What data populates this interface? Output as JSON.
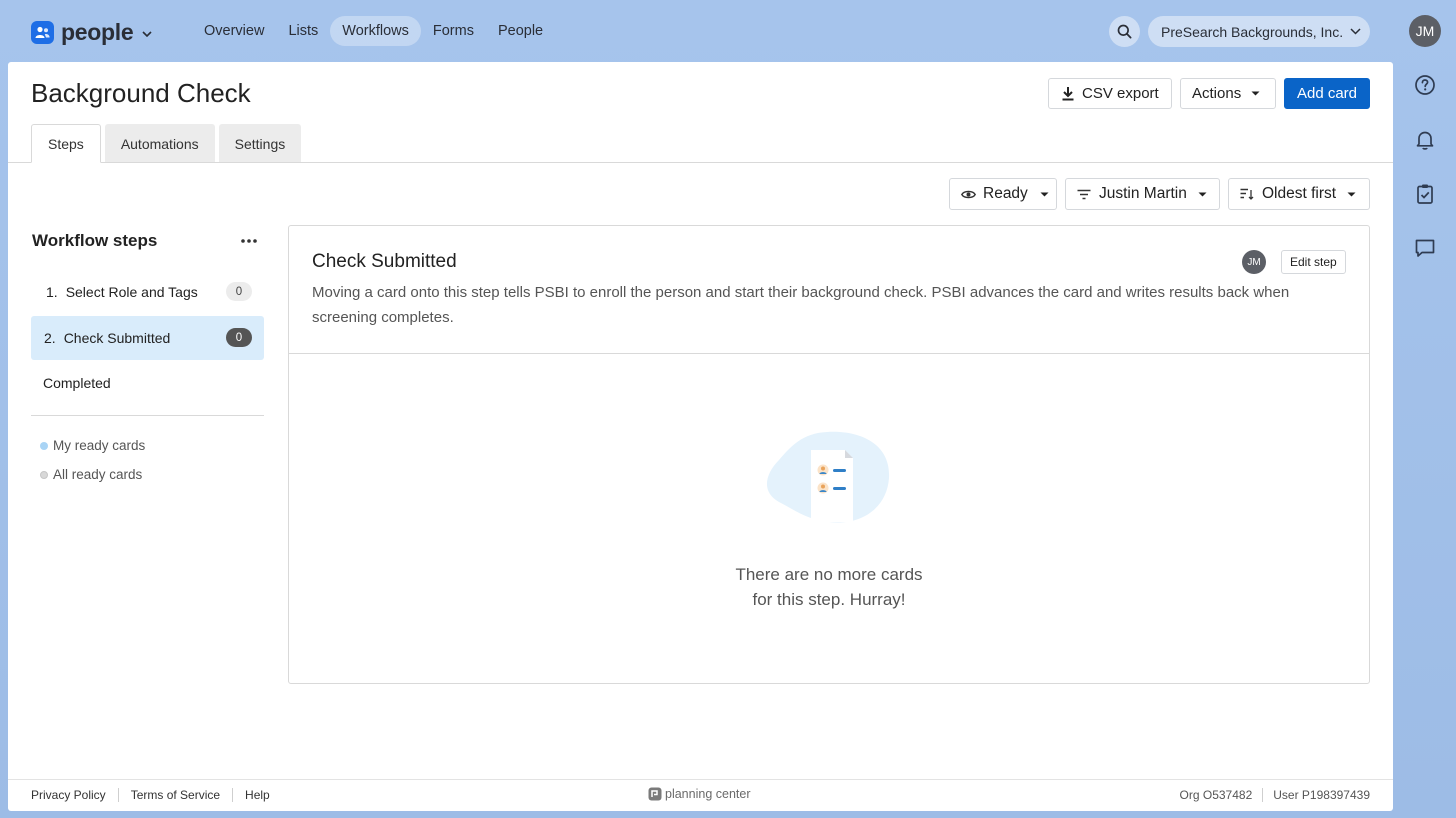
{
  "app": {
    "name": "people",
    "user_initials": "JM",
    "org_name": "PreSearch Backgrounds, Inc."
  },
  "nav": {
    "items": [
      {
        "label": "Overview",
        "active": false
      },
      {
        "label": "Lists",
        "active": false
      },
      {
        "label": "Workflows",
        "active": true
      },
      {
        "label": "Forms",
        "active": false
      },
      {
        "label": "People",
        "active": false
      }
    ]
  },
  "page": {
    "title": "Background Check",
    "csv_export_label": "CSV export",
    "actions_label": "Actions",
    "add_card_label": "Add card"
  },
  "tabs": [
    {
      "label": "Steps",
      "active": true
    },
    {
      "label": "Automations",
      "active": false
    },
    {
      "label": "Settings",
      "active": false
    }
  ],
  "filters": {
    "status": "Ready",
    "assignee": "Justin Martin",
    "sort": "Oldest first"
  },
  "sidebar": {
    "title": "Workflow steps",
    "steps": [
      {
        "number": "1.",
        "label": "Select Role and Tags",
        "count": "0",
        "active": false
      },
      {
        "number": "2.",
        "label": "Check Submitted",
        "count": "0",
        "active": true
      }
    ],
    "completed_label": "Completed",
    "ready_links": [
      {
        "label": "My ready cards",
        "color": "#a9d4f5"
      },
      {
        "label": "All ready cards",
        "color": "#d8d8d8"
      }
    ]
  },
  "step_card": {
    "title": "Check Submitted",
    "assignee_initials": "JM",
    "edit_label": "Edit step",
    "description": "Moving a card onto this step tells PSBI to enroll the person and start their background check. PSBI advances the card and writes results back when screening completes.",
    "empty_line1": "There are no more cards",
    "empty_line2": "for this step. Hurray!"
  },
  "footer": {
    "privacy": "Privacy Policy",
    "terms": "Terms of Service",
    "help": "Help",
    "brand": "planning center",
    "org_id": "Org O537482",
    "user_id": "User P198397439"
  },
  "colors": {
    "primary": "#0a64c8",
    "active_step_bg": "#d9ecfb",
    "background": "#a6c4ec"
  }
}
